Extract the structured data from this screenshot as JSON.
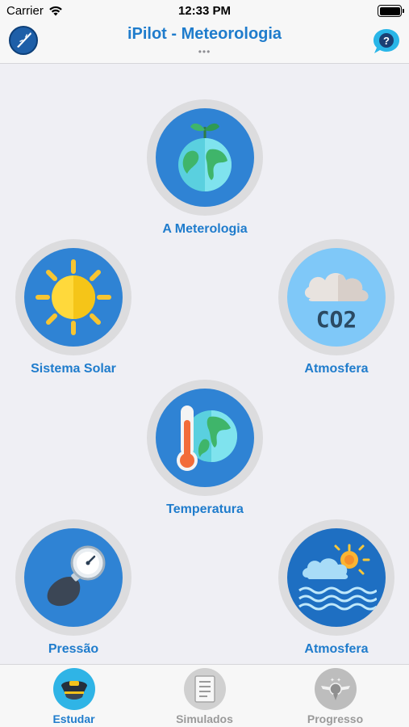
{
  "status_bar": {
    "carrier": "Carrier",
    "time": "12:33 PM"
  },
  "nav": {
    "title": "iPilot - Meteorologia",
    "dots": "•••"
  },
  "topics": [
    {
      "label": "A Meterologia"
    },
    {
      "label": "Sistema Solar"
    },
    {
      "label": "Atmosfera"
    },
    {
      "label": "Temperatura"
    },
    {
      "label": "Pressão"
    },
    {
      "label": "Atmosfera"
    }
  ],
  "co2_text": "CO2",
  "tabs": [
    {
      "label": "Estudar",
      "active": true
    },
    {
      "label": "Simulados",
      "active": false
    },
    {
      "label": "Progresso",
      "active": false
    }
  ],
  "colors": {
    "accent": "#1f7ccc",
    "disc_blue": "#2f83d4",
    "inactive_tab": "#9a9a9a"
  }
}
